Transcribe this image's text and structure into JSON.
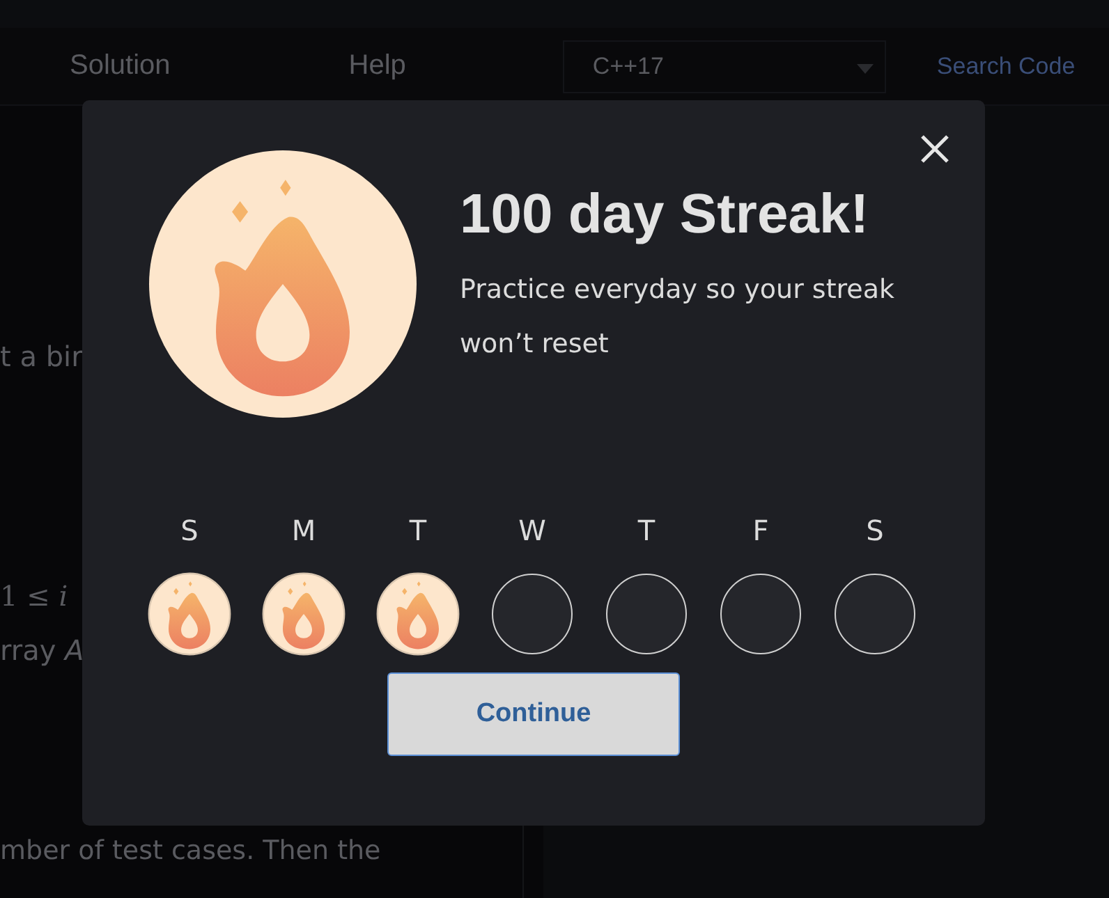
{
  "nav": {
    "items": [
      "Solution",
      "Help"
    ],
    "language_select": {
      "value": "C++17"
    },
    "search_link": "Search Code"
  },
  "background_text": [
    "t a bir",
    "1 ≤ *i*",
    "rray *A*",
    "mber of test cases. Then the"
  ],
  "modal": {
    "title": "100 day Streak!",
    "message": "Practice everyday so your streak won’t reset",
    "days": [
      {
        "label": "S",
        "done": true
      },
      {
        "label": "M",
        "done": true
      },
      {
        "label": "T",
        "done": true
      },
      {
        "label": "W",
        "done": false
      },
      {
        "label": "T",
        "done": false
      },
      {
        "label": "F",
        "done": false
      },
      {
        "label": "S",
        "done": false
      }
    ],
    "button": "Continue"
  }
}
